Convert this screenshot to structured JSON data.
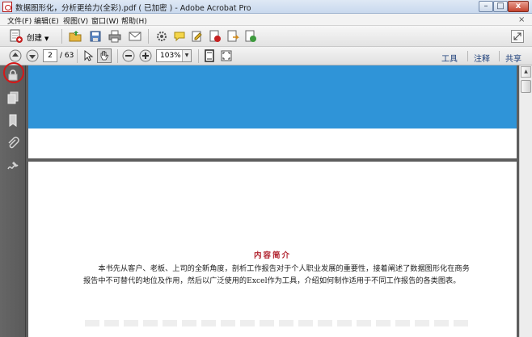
{
  "window": {
    "title": "数据图形化，分析更给力(全彩).pdf ( 已加密 ) - Adobe Acrobat Pro"
  },
  "menu": {
    "items": [
      {
        "label": "文件(F)"
      },
      {
        "label": "编辑(E)"
      },
      {
        "label": "视图(V)"
      },
      {
        "label": "窗口(W)"
      },
      {
        "label": "帮助(H)"
      }
    ],
    "close_glyph": "×"
  },
  "toolbar": {
    "create_label": "创建",
    "current_page": "2",
    "total_pages": "/ 63",
    "zoom": "103%",
    "panels": {
      "tools": "工具",
      "comment": "注释",
      "share": "共享"
    }
  },
  "document": {
    "heading": "内容简介",
    "body": "本书先从客户、老板、上司的全新角度，剖析工作报告对于个人职业发展的重要性，接着阐述了数据图形化在商务报告中不可替代的地位及作用，然后以广泛使用的Excel作为工具，介绍如何制作适用于不同工作报告的各类图表。"
  },
  "colors": {
    "blue_band": "#2f94d8",
    "heading_red": "#b0202c",
    "highlight_circle": "#d51818"
  }
}
